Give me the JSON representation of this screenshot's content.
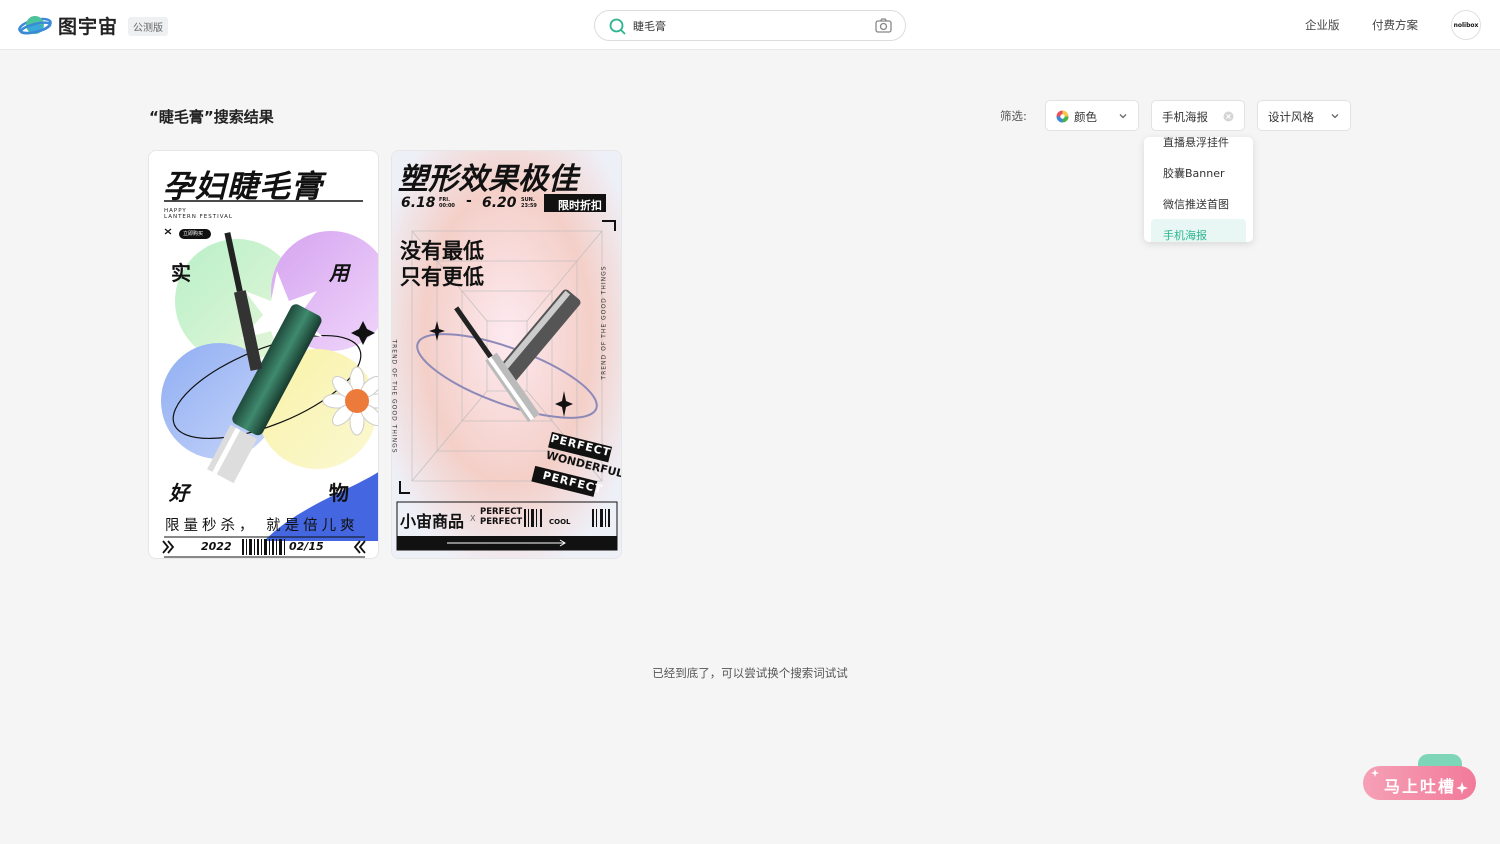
{
  "header": {
    "logo_text": "图宇宙",
    "badge": "公测版",
    "search": {
      "value": "睫毛膏",
      "placeholder": ""
    },
    "nav": [
      "企业版",
      "付费方案"
    ],
    "avatar_text": "nolibox"
  },
  "results": {
    "title": "“睫毛膏”搜索结果",
    "filter_label": "筛选:",
    "filters": {
      "color": "颜色",
      "size": "手机海报",
      "style": "设计风格"
    },
    "dropdown": {
      "items": [
        "直播悬浮挂件",
        "胶囊Banner",
        "微信推送首图",
        "手机海报"
      ],
      "selected": "手机海报"
    }
  },
  "cards": [
    {
      "title": "孕妇睫毛膏",
      "sub1": "HAPPY",
      "sub2": "LANTERN FESTIVAL",
      "tag": "立即购买",
      "corner_words": [
        "实",
        "用",
        "好",
        "物"
      ],
      "slogan": "限量秒杀， 就是倍儿爽",
      "date_start": "2022",
      "date_end": "02/15"
    },
    {
      "title": "塑形效果极佳",
      "date_range": "6.18",
      "date_range_small": "FRI. 00:00",
      "date_range_2": "6.20",
      "date_range_small_2": "SUN. 23:59",
      "promo": "限时折扣",
      "headline1": "没有最低",
      "headline2": "只有更低",
      "side_text": "TREND OF THE GOOD THINGS",
      "stickers": [
        "PERFECT",
        "WONDERFUL",
        "PERFECT"
      ],
      "brand": "小宙商品",
      "brand_x": "X",
      "brand_tag1": "PERFECT",
      "brand_tag2": "PERFECT",
      "cool": "COOL"
    }
  ],
  "footer_message": "已经到底了，可以尝试换个搜索词试试",
  "feedback_button": "马上吐槽",
  "colors": {
    "accent": "#2bb58f",
    "feedback": "#f27a9a"
  }
}
